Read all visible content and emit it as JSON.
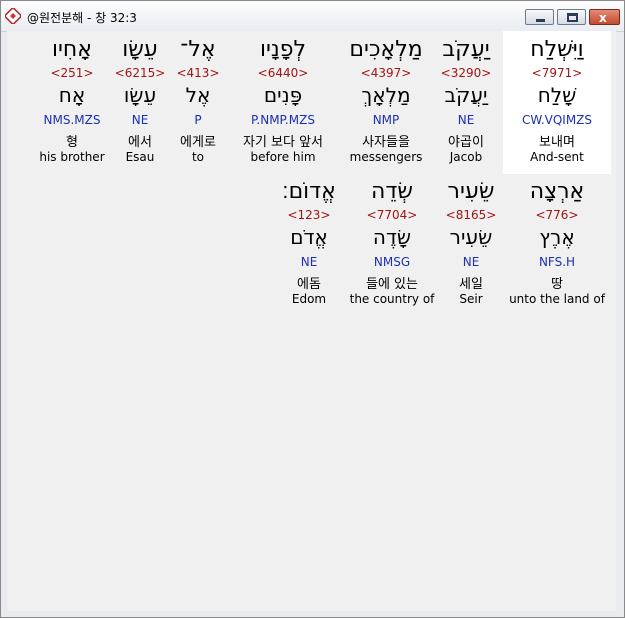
{
  "window": {
    "title": "@원전분해 - 창 32:3",
    "controls": {
      "minimize": "",
      "maximize": "",
      "close": "x"
    }
  },
  "rows": [
    {
      "words": [
        {
          "hebrew": "וַיִּשְׁלַח",
          "strong": "<7971>",
          "lemma": "שָׁלַח",
          "parse": "CW.VQIMZS",
          "korean": "보내며",
          "english": "And-sent"
        },
        {
          "hebrew": "יַעֲקֹב",
          "strong": "<3290>",
          "lemma": "יַעֲקֹב",
          "parse": "NE",
          "korean": "야곱이",
          "english": "Jacob"
        },
        {
          "hebrew": "מַלְאָכִים",
          "strong": "<4397>",
          "lemma": "מַלְאָךְ",
          "parse": "NMP",
          "korean": "사자들을",
          "english": "messengers"
        },
        {
          "hebrew": "לְפָנָיו",
          "strong": "<6440>",
          "lemma": "פָּנִים",
          "parse": "P.NMP.MZS",
          "korean": "자기 보다 앞서",
          "english": "before him"
        },
        {
          "hebrew": "אֶל־",
          "strong": "<413>",
          "lemma": "אֶל",
          "parse": "P",
          "korean": "에게로",
          "english": "to"
        },
        {
          "hebrew": "עֵשָׂו",
          "strong": "<6215>",
          "lemma": "עֵשָׂו",
          "parse": "NE",
          "korean": "에서",
          "english": "Esau"
        },
        {
          "hebrew": "אָחִיו",
          "strong": "<251>",
          "lemma": "אָח",
          "parse": "NMS.MZS",
          "korean": "형",
          "english": "his brother"
        }
      ]
    },
    {
      "words": [
        {
          "hebrew": "אַרְצָה",
          "strong": "<776>",
          "lemma": "אֶרֶץ",
          "parse": "NFS.H",
          "korean": "땅",
          "english": "unto the land of"
        },
        {
          "hebrew": "שֵׂעִיר",
          "strong": "<8165>",
          "lemma": "שֵׂעִיר",
          "parse": "NE",
          "korean": "세일",
          "english": "Seir"
        },
        {
          "hebrew": "שְׂדֵה",
          "strong": "<7704>",
          "lemma": "שָׂדֶה",
          "parse": "NMSG",
          "korean": "들에 있는",
          "english": "the country of"
        },
        {
          "hebrew": "אֱדוֹם׃",
          "strong": "<123>",
          "lemma": "אֱדֹם",
          "parse": "NE",
          "korean": "에돔",
          "english": "Edom"
        }
      ]
    }
  ],
  "colors": {
    "strong_number": "#a01414",
    "parsing_code": "#1b2fb5",
    "selected_background": "#ffffff"
  }
}
